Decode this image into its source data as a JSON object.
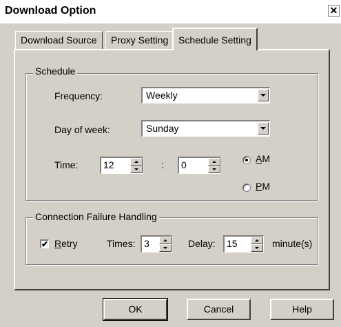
{
  "window": {
    "title": "Download Option",
    "close_glyph": "✕"
  },
  "tabs": [
    {
      "label": "Download Source"
    },
    {
      "label": "Proxy Setting"
    },
    {
      "label": "Schedule Setting"
    }
  ],
  "schedule": {
    "legend": "Schedule",
    "frequency_label": "Frequency:",
    "frequency_value": "Weekly",
    "day_label": "Day of week:",
    "day_value": "Sunday",
    "time_label": "Time:",
    "hour_value": "12",
    "separator": ":",
    "minute_value": "0",
    "am_label_first": "A",
    "am_label_rest": "M",
    "pm_label_first": "P",
    "pm_label_rest": "M",
    "selected": "AM"
  },
  "failure": {
    "legend": "Connection Failure Handling",
    "retry_label_first": "R",
    "retry_label_rest": "etry",
    "retry_checked": true,
    "check_glyph": "✔",
    "times_label": "Times:",
    "times_value": "3",
    "delay_label": "Delay:",
    "delay_value": "15",
    "unit_label": "minute(s)"
  },
  "buttons": {
    "ok": "OK",
    "cancel": "Cancel",
    "help": "Help"
  }
}
